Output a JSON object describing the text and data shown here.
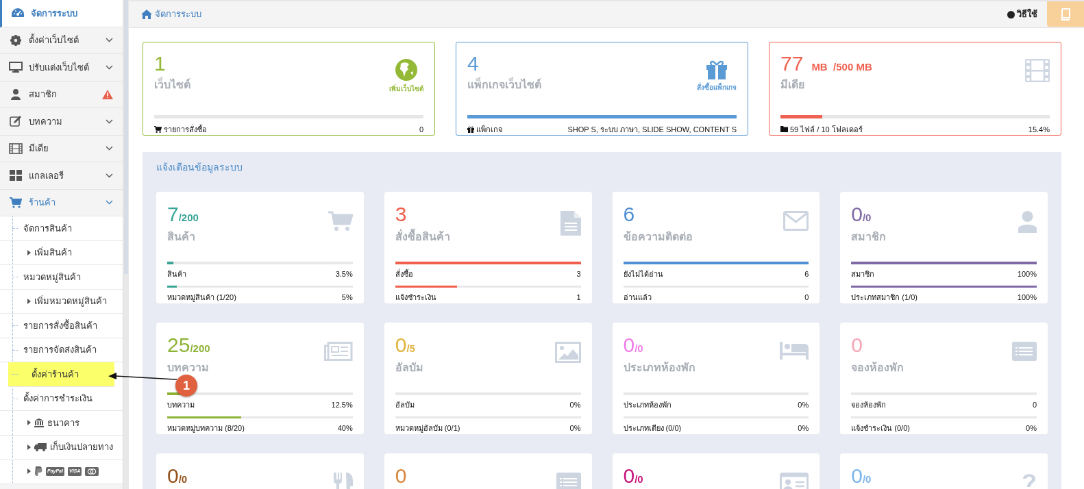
{
  "sidebar": {
    "items": [
      {
        "label": "จัดการระบบ",
        "selected": true
      },
      {
        "label": "ตั้งค่าเว็บไซต์",
        "selected": false,
        "expanded": false
      },
      {
        "label": "ปรับแต่งเว็บไซต์",
        "selected": false,
        "expanded": false
      },
      {
        "label": "สมาชิก",
        "selected": false,
        "alert": true
      },
      {
        "label": "บทความ",
        "selected": false,
        "expanded": false
      },
      {
        "label": "มีเดีย",
        "selected": false,
        "expanded": false
      },
      {
        "label": "แกลเลอรี",
        "selected": false,
        "expanded": false
      },
      {
        "label": "ร้านค้า",
        "selected": false,
        "expanded": true,
        "children": [
          {
            "label": "จัดการสินค้า",
            "highlighted": false,
            "children": [
              {
                "label": "เพิ่มสินค้า"
              }
            ]
          },
          {
            "label": "หมวดหมู่สินค้า",
            "highlighted": false,
            "children": [
              {
                "label": "เพิ่มหมวดหมู่สินค้า"
              }
            ]
          },
          {
            "label": "รายการสั่งซื้อสินค้า",
            "highlighted": false
          },
          {
            "label": "รายการจัดส่งสินค้า",
            "highlighted": false
          },
          {
            "label": "ตั้งค่าร้านค้า",
            "highlighted": true
          },
          {
            "label": "ตั้งค่าการชำระเงิน",
            "highlighted": false,
            "children": [
              {
                "label": "ธนาคาร"
              },
              {
                "label": "เก็บเงินปลายทาง"
              },
              {
                "badges": [
                  "PayPal",
                  "VISA"
                ]
              }
            ]
          }
        ]
      }
    ]
  },
  "header": {
    "breadcrumb": "จัดการระบบ",
    "help": "วิธีใช้"
  },
  "top_cards": [
    {
      "value": "1",
      "label": "เว็บไซต์",
      "action": "เพิ่มเว็บไซต์",
      "color": "#94b937",
      "level": 0,
      "footer": "รายการสั่งซื้อ",
      "footer_value": "0"
    },
    {
      "value": "4",
      "label": "แพ็กเกจเว็บไซต์",
      "action": "สั่งซื้อแพ็กเกจ",
      "color": "#5b9bd5",
      "level": 1,
      "footer": "แพ็กเกจ",
      "footer_value": "SHOP S, ระบบ ภาษา, SLIDE SHOW, CONTENT S"
    },
    {
      "value": "77",
      "unit": "MB  /500 MB",
      "label": "มีเดีย",
      "color": "#ef6150",
      "level": 0.154,
      "footer": "59 ไฟล์ / 10 โฟลเดอร์",
      "footer_value": "15.4%"
    }
  ],
  "notice_panel": {
    "title": "แจ้งเตือนข้อมูลระบบ",
    "cards": [
      {
        "value": "7",
        "suffix": "/200",
        "label": "สินค้า",
        "color": "#3aa597",
        "rows": [
          {
            "label": "สินค้า",
            "value": "3.5%",
            "level": 0.035
          },
          {
            "label": "หมวดหมู่สินค้า (1/20)",
            "value": "5%",
            "level": 0.05
          }
        ]
      },
      {
        "value": "3",
        "label": "สั่งซื้อสินค้า",
        "color": "#ef5f4c",
        "rows": [
          {
            "label": "สั่งซื้อ",
            "value": "3",
            "level": 1
          },
          {
            "label": "แจ้งชำระเงิน",
            "value": "1",
            "level": 0.333
          }
        ]
      },
      {
        "value": "6",
        "label": "ข้อความติดต่อ",
        "color": "#4f8fd3",
        "rows": [
          {
            "label": "ยังไม่ได้อ่าน",
            "value": "6",
            "level": 1
          },
          {
            "label": "อ่านแล้ว",
            "value": "0",
            "level": 0
          }
        ]
      },
      {
        "value": "0",
        "suffix": "/0",
        "label": "สมาชิก",
        "color": "#7f6aa6",
        "rows": [
          {
            "label": "สมาชิก",
            "value": "100%",
            "level": 1
          },
          {
            "label": "ประเภทสมาชิก (1/0)",
            "value": "100%",
            "level": 1
          }
        ]
      },
      {
        "value": "25",
        "suffix": "/200",
        "label": "บทความ",
        "color": "#8db336",
        "rows": [
          {
            "label": "บทความ",
            "value": "12.5%",
            "level": 0.125
          },
          {
            "label": "หมวดหมู่บทความ (8/20)",
            "value": "40%",
            "level": 0.4
          }
        ]
      },
      {
        "value": "0",
        "suffix": "/5",
        "label": "อัลบัม",
        "color": "#e0b43c",
        "rows": [
          {
            "label": "อัลบัม",
            "value": "0%",
            "level": 0
          },
          {
            "label": "หมวดหมู่อัลบัม (0/1)",
            "value": "0%",
            "level": 0
          }
        ]
      },
      {
        "value": "0",
        "suffix": "/0",
        "label": "ประเภทห้องพัก",
        "color": "#f07de8",
        "rows": [
          {
            "label": "ประเภทห้องพัก",
            "value": "0%",
            "level": 0
          },
          {
            "label": "ประเภทเตียง (0/0)",
            "value": "0%",
            "level": 0
          }
        ]
      },
      {
        "value": "0",
        "label": "จองห้องพัก",
        "color": "#f6a5b5",
        "rows": [
          {
            "label": "จองห้องพัก",
            "value": "0",
            "level": 0
          },
          {
            "label": "แจ้งชำระเงิน (0/0)",
            "value": "0%",
            "level": 0
          }
        ]
      },
      {
        "value": "0",
        "suffix": "/0",
        "color": "#95521c"
      },
      {
        "value": "0",
        "color": "#d8863a"
      },
      {
        "value": "0",
        "suffix": "/0",
        "color": "#c8157e"
      },
      {
        "value": "0",
        "suffix": "/0",
        "color": "#7db6ec"
      }
    ]
  },
  "annotation": {
    "number": "1"
  }
}
